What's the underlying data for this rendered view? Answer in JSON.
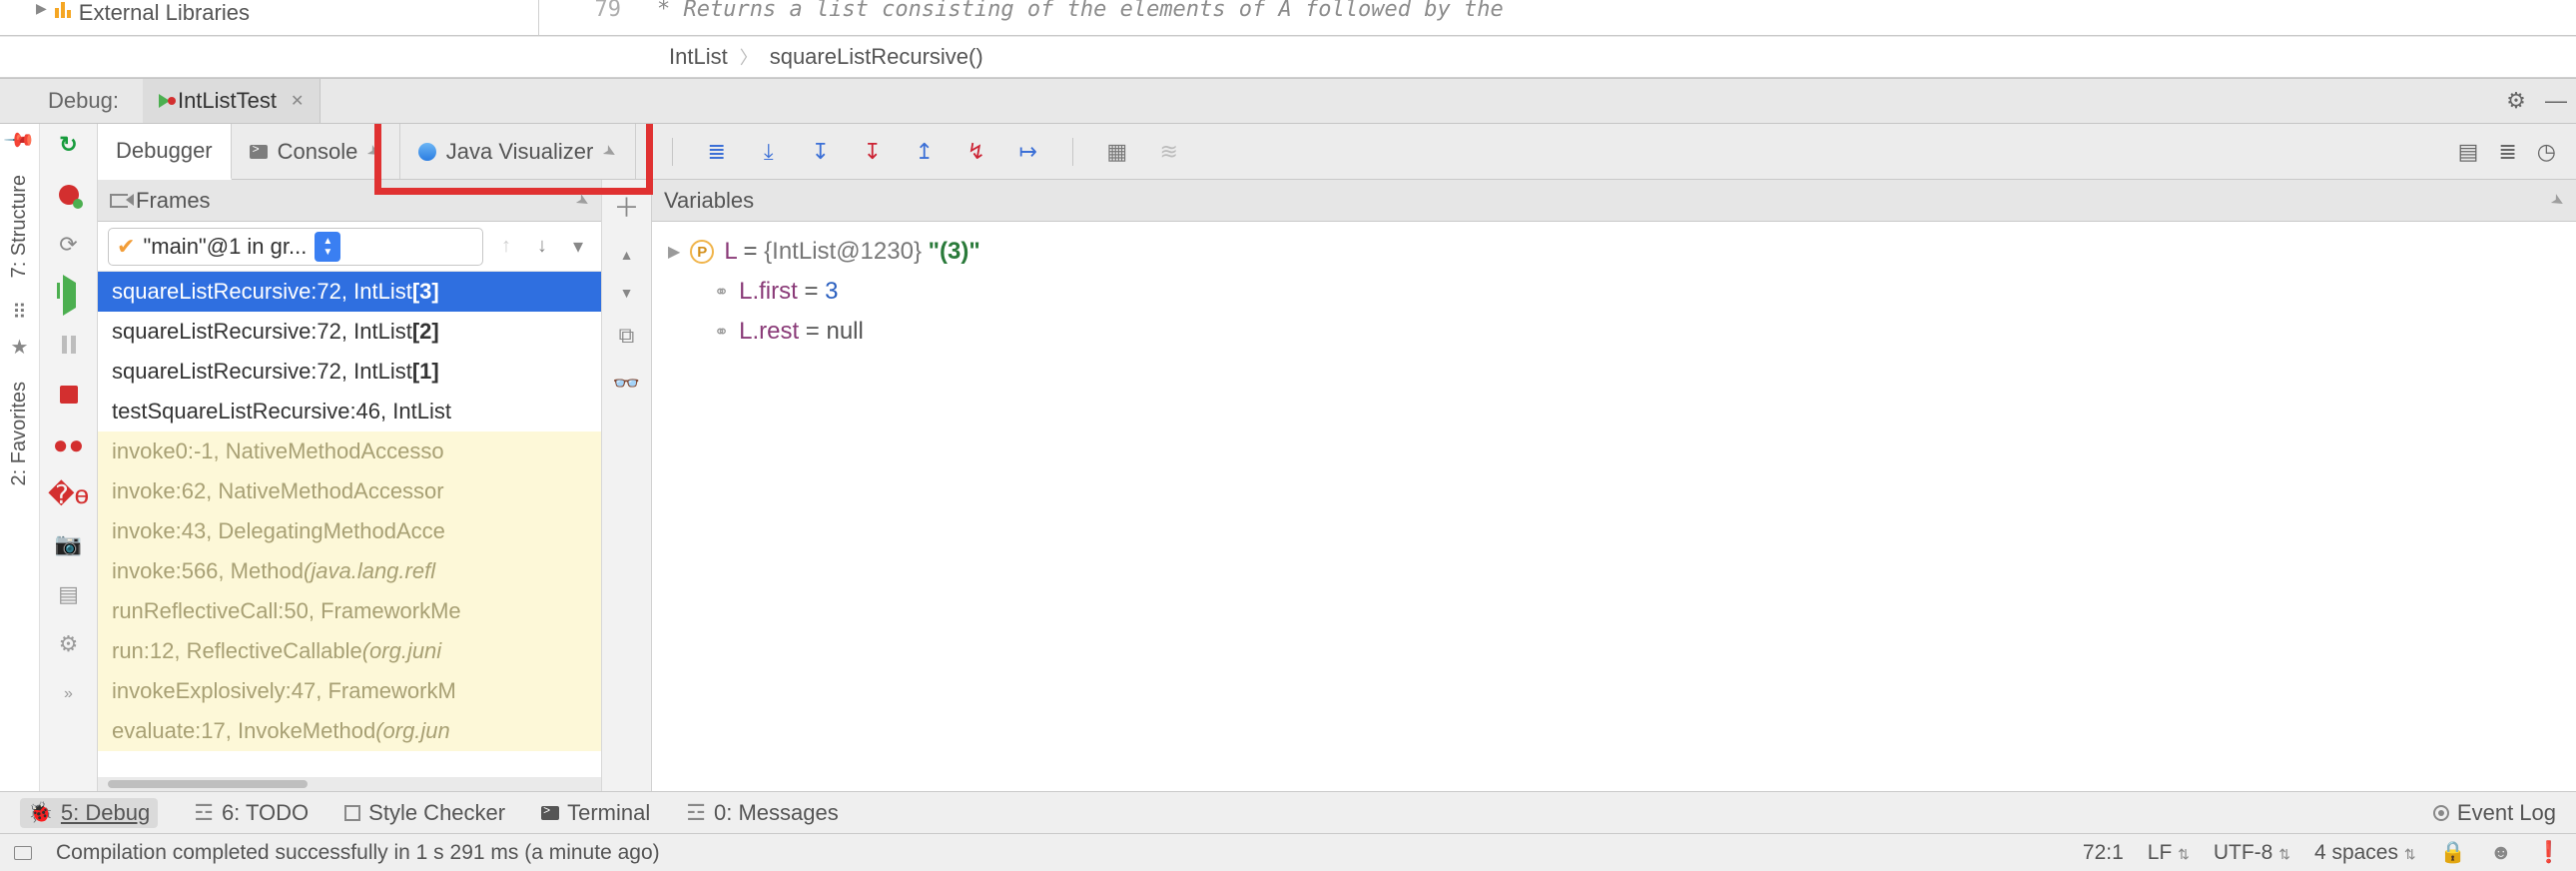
{
  "editor": {
    "gutter_line": "79",
    "comment": "* Returns a list consisting of the elements of A followed by the",
    "proj_node": "External Libraries",
    "crumbs": {
      "a": "IntList",
      "b": "squareListRecursive()"
    }
  },
  "debug": {
    "label": "Debug:",
    "tab": "IntListTest"
  },
  "inner_tabs": {
    "debugger": "Debugger",
    "console": "Console",
    "java_viz": "Java Visualizer"
  },
  "frames": {
    "title": "Frames",
    "thread": "\"main\"@1 in gr...",
    "items": [
      {
        "t": "squareListRecursive:72, IntList ",
        "b": "[3]",
        "sel": true
      },
      {
        "t": "squareListRecursive:72, IntList ",
        "b": "[2]"
      },
      {
        "t": "squareListRecursive:72, IntList ",
        "b": "[1]"
      },
      {
        "t": "testSquareListRecursive:46, IntList",
        "b": ""
      },
      {
        "t": "invoke0:-1, NativeMethodAccesso",
        "lib": true
      },
      {
        "t": "invoke:62, NativeMethodAccessor",
        "lib": true
      },
      {
        "t": "invoke:43, DelegatingMethodAcce",
        "lib": true
      },
      {
        "t": "invoke:566, Method ",
        "it": "(java.lang.refl",
        "lib": true
      },
      {
        "t": "runReflectiveCall:50, FrameworkMe",
        "lib": true
      },
      {
        "t": "run:12, ReflectiveCallable ",
        "it": "(org.juni",
        "lib": true
      },
      {
        "t": "invokeExplosively:47, FrameworkM",
        "lib": true
      },
      {
        "t": "evaluate:17, InvokeMethod ",
        "it": "(org.jun",
        "lib": true
      }
    ]
  },
  "variables": {
    "title": "Variables",
    "root": {
      "name": "L",
      "obj": "{IntList@1230}",
      "str": "\"(3)\""
    },
    "first": {
      "name": "L.first",
      "val": "3"
    },
    "rest": {
      "name": "L.rest",
      "val": "null"
    }
  },
  "bottom": {
    "debug": "5: Debug",
    "todo": "6: TODO",
    "style": "Style Checker",
    "terminal": "Terminal",
    "messages": "0: Messages",
    "eventlog": "Event Log"
  },
  "status": {
    "msg": "Compilation completed successfully in 1 s 291 ms (a minute ago)",
    "pos": "72:1",
    "le": "LF",
    "enc": "UTF-8",
    "indent": "4 spaces"
  }
}
